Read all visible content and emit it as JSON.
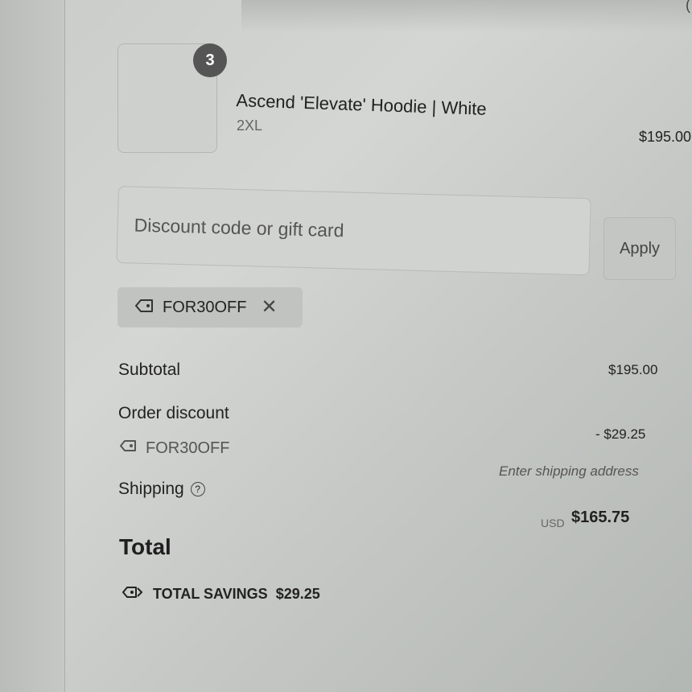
{
  "product": {
    "quantity": "3",
    "name": "Ascend 'Elevate' Hoodie | White",
    "variant": "2XL",
    "price": "$195.00"
  },
  "discount": {
    "placeholder": "Discount code or gift card",
    "apply_label": "Apply",
    "applied_code": "FOR30OFF",
    "remove_symbol": "✕"
  },
  "summary": {
    "subtotal_label": "Subtotal",
    "subtotal_value": "$195.00",
    "order_discount_label": "Order discount",
    "order_discount_code": "FOR30OFF",
    "order_discount_value": "- $29.25",
    "shipping_label": "Shipping",
    "shipping_help": "?",
    "shipping_value": "Enter shipping address",
    "total_label": "Total",
    "currency": "USD",
    "total_value": "$165.75",
    "savings_label": "TOTAL SAVINGS",
    "savings_value": "$29.25"
  },
  "icons": [
    "tag-icon",
    "close-icon",
    "help-icon"
  ]
}
